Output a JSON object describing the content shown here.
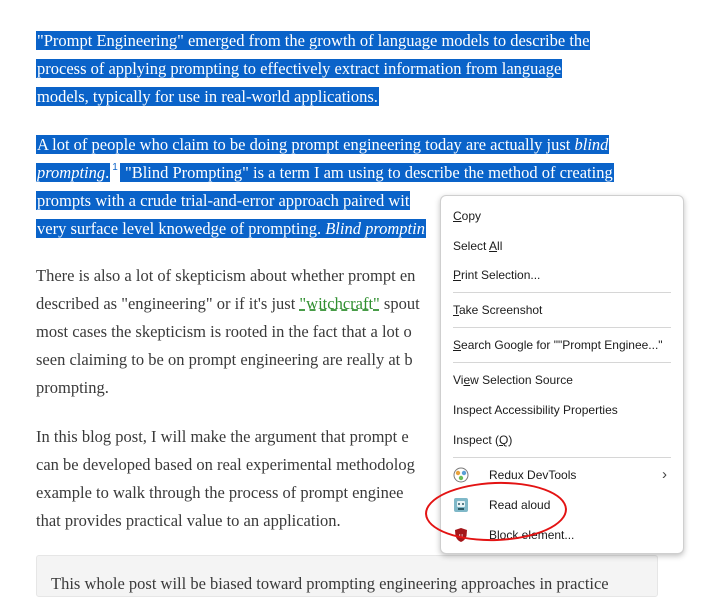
{
  "article": {
    "p1": [
      "\"Prompt Engineering\" emerged from the growth of language models to describe the",
      "process of applying prompting to effectively extract information from language",
      "models, typically for use in real-world applications."
    ],
    "p2_l1_a": "A lot of people who claim to be doing prompt engineering today are actually just ",
    "p2_l1_b": "blind",
    "p2_l2_a": "prompting",
    "p2_l2_b": ".",
    "p2_sup": "1",
    "p2_l2_c": " \"Blind Prompting\" is a term I am using to describe the method of creating",
    "p2_l3": "prompts with a crude trial-and-error approach paired wit",
    "p2_l4_a": "very surface level knowedge of prompting. ",
    "p2_l4_b": "Blind promptin",
    "p3_l1": "There is also a lot of skepticism about whether prompt en",
    "p3_l2_a": "described as \"engineering\" or if it's just ",
    "p3_l2_link": "\"witchcraft\"",
    "p3_l2_b": " spout",
    "p3_l3": "most cases the skepticism is rooted in the fact that a lot o",
    "p3_l4": "seen claiming to be on prompt engineering are really at b",
    "p3_l5": "prompting.",
    "p4": [
      "In this blog post, I will make the argument that prompt e",
      "can be developed based on real experimental methodolog",
      "example to walk through the process of prompt enginee",
      "that provides practical value to an application."
    ],
    "quote": "This whole post will be biased toward prompting engineering approaches in practice"
  },
  "context_menu": {
    "copy": {
      "acc": "C",
      "rest": "opy"
    },
    "select_all": {
      "pre": "Select ",
      "acc": "A",
      "rest": "ll"
    },
    "print_selection": {
      "acc": "P",
      "rest": "rint Selection..."
    },
    "take_screenshot": {
      "acc": "T",
      "rest": "ake Screenshot"
    },
    "search_google": {
      "pre": "",
      "acc": "S",
      "rest": "earch Google for \"\"Prompt Enginee...\""
    },
    "view_selection_source": {
      "pre": "Vi",
      "acc": "e",
      "rest": "w Selection Source"
    },
    "inspect_accessibility": "Inspect Accessibility Properties",
    "inspect": {
      "pre": "Inspect (",
      "acc": "Q",
      "rest": ")"
    },
    "redux_devtools": "Redux DevTools",
    "read_aloud": "Read aloud",
    "block_element": "Block element..."
  },
  "colors": {
    "selection": "#0a63c9",
    "annotation": "#e31313",
    "link": "#2f8f2f"
  }
}
